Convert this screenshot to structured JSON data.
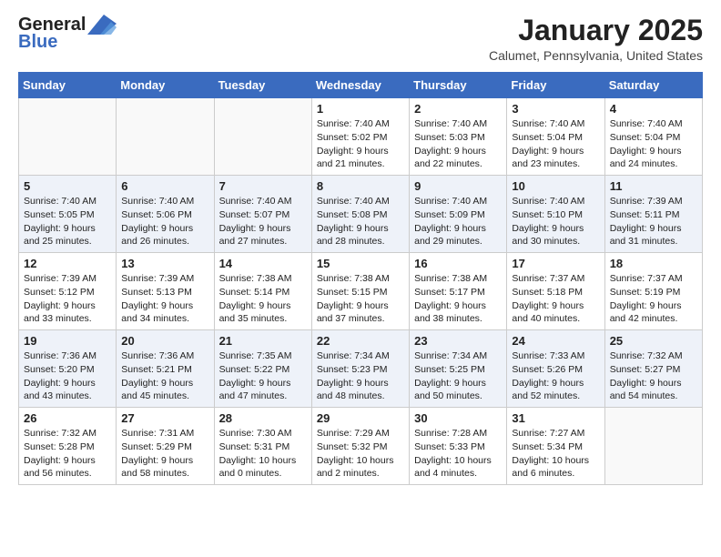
{
  "header": {
    "logo_general": "General",
    "logo_blue": "Blue",
    "month_title": "January 2025",
    "location": "Calumet, Pennsylvania, United States"
  },
  "weekdays": [
    "Sunday",
    "Monday",
    "Tuesday",
    "Wednesday",
    "Thursday",
    "Friday",
    "Saturday"
  ],
  "weeks": [
    [
      {
        "day": "",
        "info": ""
      },
      {
        "day": "",
        "info": ""
      },
      {
        "day": "",
        "info": ""
      },
      {
        "day": "1",
        "info": "Sunrise: 7:40 AM\nSunset: 5:02 PM\nDaylight: 9 hours\nand 21 minutes."
      },
      {
        "day": "2",
        "info": "Sunrise: 7:40 AM\nSunset: 5:03 PM\nDaylight: 9 hours\nand 22 minutes."
      },
      {
        "day": "3",
        "info": "Sunrise: 7:40 AM\nSunset: 5:04 PM\nDaylight: 9 hours\nand 23 minutes."
      },
      {
        "day": "4",
        "info": "Sunrise: 7:40 AM\nSunset: 5:04 PM\nDaylight: 9 hours\nand 24 minutes."
      }
    ],
    [
      {
        "day": "5",
        "info": "Sunrise: 7:40 AM\nSunset: 5:05 PM\nDaylight: 9 hours\nand 25 minutes."
      },
      {
        "day": "6",
        "info": "Sunrise: 7:40 AM\nSunset: 5:06 PM\nDaylight: 9 hours\nand 26 minutes."
      },
      {
        "day": "7",
        "info": "Sunrise: 7:40 AM\nSunset: 5:07 PM\nDaylight: 9 hours\nand 27 minutes."
      },
      {
        "day": "8",
        "info": "Sunrise: 7:40 AM\nSunset: 5:08 PM\nDaylight: 9 hours\nand 28 minutes."
      },
      {
        "day": "9",
        "info": "Sunrise: 7:40 AM\nSunset: 5:09 PM\nDaylight: 9 hours\nand 29 minutes."
      },
      {
        "day": "10",
        "info": "Sunrise: 7:40 AM\nSunset: 5:10 PM\nDaylight: 9 hours\nand 30 minutes."
      },
      {
        "day": "11",
        "info": "Sunrise: 7:39 AM\nSunset: 5:11 PM\nDaylight: 9 hours\nand 31 minutes."
      }
    ],
    [
      {
        "day": "12",
        "info": "Sunrise: 7:39 AM\nSunset: 5:12 PM\nDaylight: 9 hours\nand 33 minutes."
      },
      {
        "day": "13",
        "info": "Sunrise: 7:39 AM\nSunset: 5:13 PM\nDaylight: 9 hours\nand 34 minutes."
      },
      {
        "day": "14",
        "info": "Sunrise: 7:38 AM\nSunset: 5:14 PM\nDaylight: 9 hours\nand 35 minutes."
      },
      {
        "day": "15",
        "info": "Sunrise: 7:38 AM\nSunset: 5:15 PM\nDaylight: 9 hours\nand 37 minutes."
      },
      {
        "day": "16",
        "info": "Sunrise: 7:38 AM\nSunset: 5:17 PM\nDaylight: 9 hours\nand 38 minutes."
      },
      {
        "day": "17",
        "info": "Sunrise: 7:37 AM\nSunset: 5:18 PM\nDaylight: 9 hours\nand 40 minutes."
      },
      {
        "day": "18",
        "info": "Sunrise: 7:37 AM\nSunset: 5:19 PM\nDaylight: 9 hours\nand 42 minutes."
      }
    ],
    [
      {
        "day": "19",
        "info": "Sunrise: 7:36 AM\nSunset: 5:20 PM\nDaylight: 9 hours\nand 43 minutes."
      },
      {
        "day": "20",
        "info": "Sunrise: 7:36 AM\nSunset: 5:21 PM\nDaylight: 9 hours\nand 45 minutes."
      },
      {
        "day": "21",
        "info": "Sunrise: 7:35 AM\nSunset: 5:22 PM\nDaylight: 9 hours\nand 47 minutes."
      },
      {
        "day": "22",
        "info": "Sunrise: 7:34 AM\nSunset: 5:23 PM\nDaylight: 9 hours\nand 48 minutes."
      },
      {
        "day": "23",
        "info": "Sunrise: 7:34 AM\nSunset: 5:25 PM\nDaylight: 9 hours\nand 50 minutes."
      },
      {
        "day": "24",
        "info": "Sunrise: 7:33 AM\nSunset: 5:26 PM\nDaylight: 9 hours\nand 52 minutes."
      },
      {
        "day": "25",
        "info": "Sunrise: 7:32 AM\nSunset: 5:27 PM\nDaylight: 9 hours\nand 54 minutes."
      }
    ],
    [
      {
        "day": "26",
        "info": "Sunrise: 7:32 AM\nSunset: 5:28 PM\nDaylight: 9 hours\nand 56 minutes."
      },
      {
        "day": "27",
        "info": "Sunrise: 7:31 AM\nSunset: 5:29 PM\nDaylight: 9 hours\nand 58 minutes."
      },
      {
        "day": "28",
        "info": "Sunrise: 7:30 AM\nSunset: 5:31 PM\nDaylight: 10 hours\nand 0 minutes."
      },
      {
        "day": "29",
        "info": "Sunrise: 7:29 AM\nSunset: 5:32 PM\nDaylight: 10 hours\nand 2 minutes."
      },
      {
        "day": "30",
        "info": "Sunrise: 7:28 AM\nSunset: 5:33 PM\nDaylight: 10 hours\nand 4 minutes."
      },
      {
        "day": "31",
        "info": "Sunrise: 7:27 AM\nSunset: 5:34 PM\nDaylight: 10 hours\nand 6 minutes."
      },
      {
        "day": "",
        "info": ""
      }
    ]
  ]
}
